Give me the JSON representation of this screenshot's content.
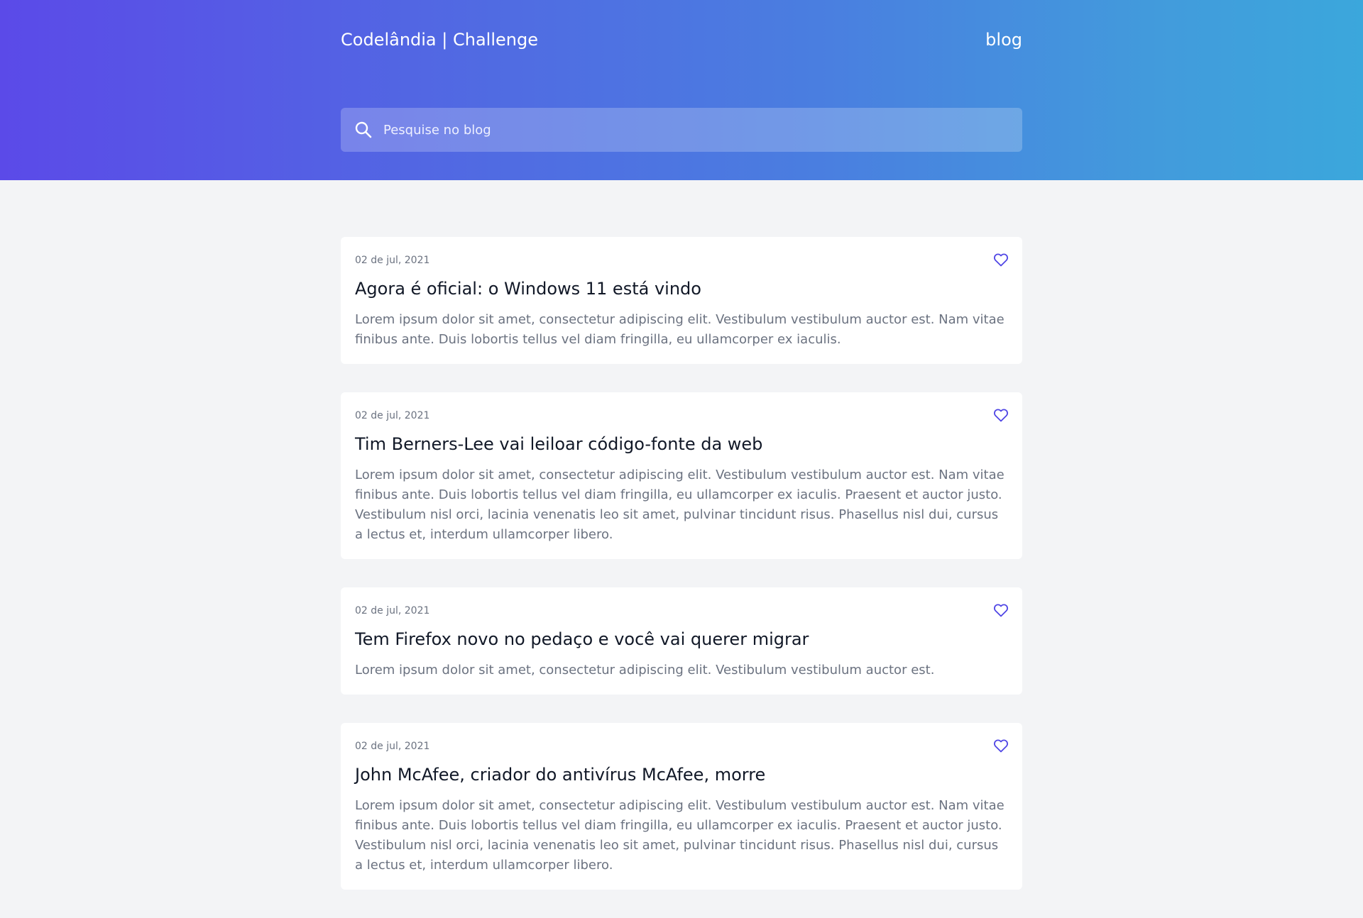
{
  "header": {
    "brand": "Codelândia | Challenge",
    "nav_blog": "blog"
  },
  "search": {
    "placeholder": "Pesquise no blog",
    "icon": "search-icon"
  },
  "colors": {
    "gradient_start": "#5b4ae8",
    "gradient_end": "#3ba7dc",
    "heart": "#5046e5",
    "background": "#f3f4f6"
  },
  "posts": [
    {
      "date": "02 de jul, 2021",
      "title": "Agora é oficial: o Windows 11 está vindo",
      "excerpt": "Lorem ipsum dolor sit amet, consectetur adipiscing elit. Vestibulum vestibulum auctor est. Nam vitae finibus ante. Duis lobortis tellus vel diam fringilla, eu ullamcorper ex iaculis.",
      "icon": "heart-icon"
    },
    {
      "date": "02 de jul, 2021",
      "title": "Tim Berners-Lee vai leiloar código-fonte da web",
      "excerpt": "Lorem ipsum dolor sit amet, consectetur adipiscing elit. Vestibulum vestibulum auctor est. Nam vitae finibus ante. Duis lobortis tellus vel diam fringilla, eu ullamcorper ex iaculis. Praesent et auctor justo. Vestibulum nisl orci, lacinia venenatis leo sit amet, pulvinar tincidunt risus. Phasellus nisl dui, cursus a lectus et, interdum ullamcorper libero.",
      "icon": "heart-icon"
    },
    {
      "date": "02 de jul, 2021",
      "title": "Tem Firefox novo no pedaço e você vai querer migrar",
      "excerpt": "Lorem ipsum dolor sit amet, consectetur adipiscing elit. Vestibulum vestibulum auctor est.",
      "icon": "heart-icon"
    },
    {
      "date": "02 de jul, 2021",
      "title": "John McAfee, criador do antivírus McAfee, morre",
      "excerpt": "Lorem ipsum dolor sit amet, consectetur adipiscing elit. Vestibulum vestibulum auctor est. Nam vitae finibus ante. Duis lobortis tellus vel diam fringilla, eu ullamcorper ex iaculis. Praesent et auctor justo. Vestibulum nisl orci, lacinia venenatis leo sit amet, pulvinar tincidunt risus. Phasellus nisl dui, cursus a lectus et, interdum ullamcorper libero.",
      "icon": "heart-icon"
    }
  ]
}
